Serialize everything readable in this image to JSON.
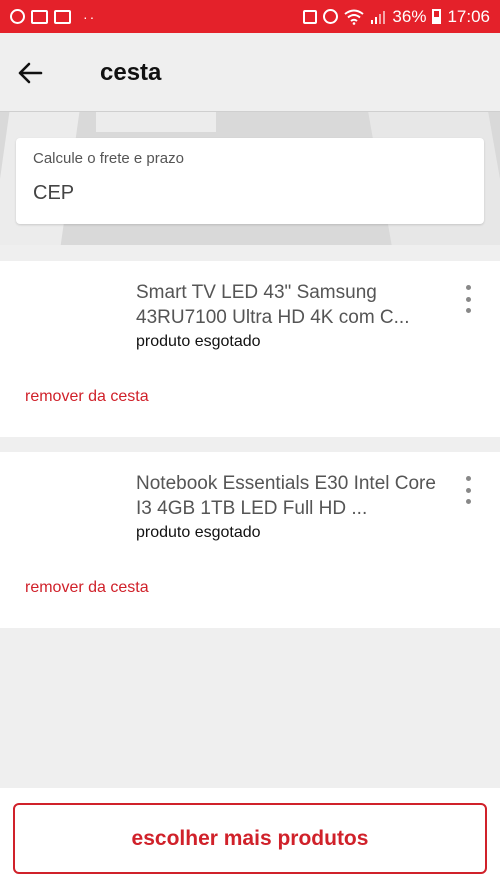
{
  "status_bar": {
    "battery": "36%",
    "time": "17:06",
    "dots": "··"
  },
  "header": {
    "title": "cesta"
  },
  "shipping": {
    "label": "Calcule o frete e prazo",
    "placeholder": "CEP"
  },
  "cart": {
    "items": [
      {
        "name": "Smart TV LED 43\" Samsung 43RU7100 Ultra HD 4K com C...",
        "status": "produto esgotado",
        "remove_label": "remover da cesta"
      },
      {
        "name": "Notebook Essentials E30 Intel Core I3 4GB 1TB LED Full HD ...",
        "status": "produto esgotado",
        "remove_label": "remover da cesta"
      }
    ]
  },
  "footer": {
    "more_products_label": "escolher mais produtos"
  },
  "colors": {
    "brand_red": "#e4212a",
    "link_red": "#d0212a"
  }
}
